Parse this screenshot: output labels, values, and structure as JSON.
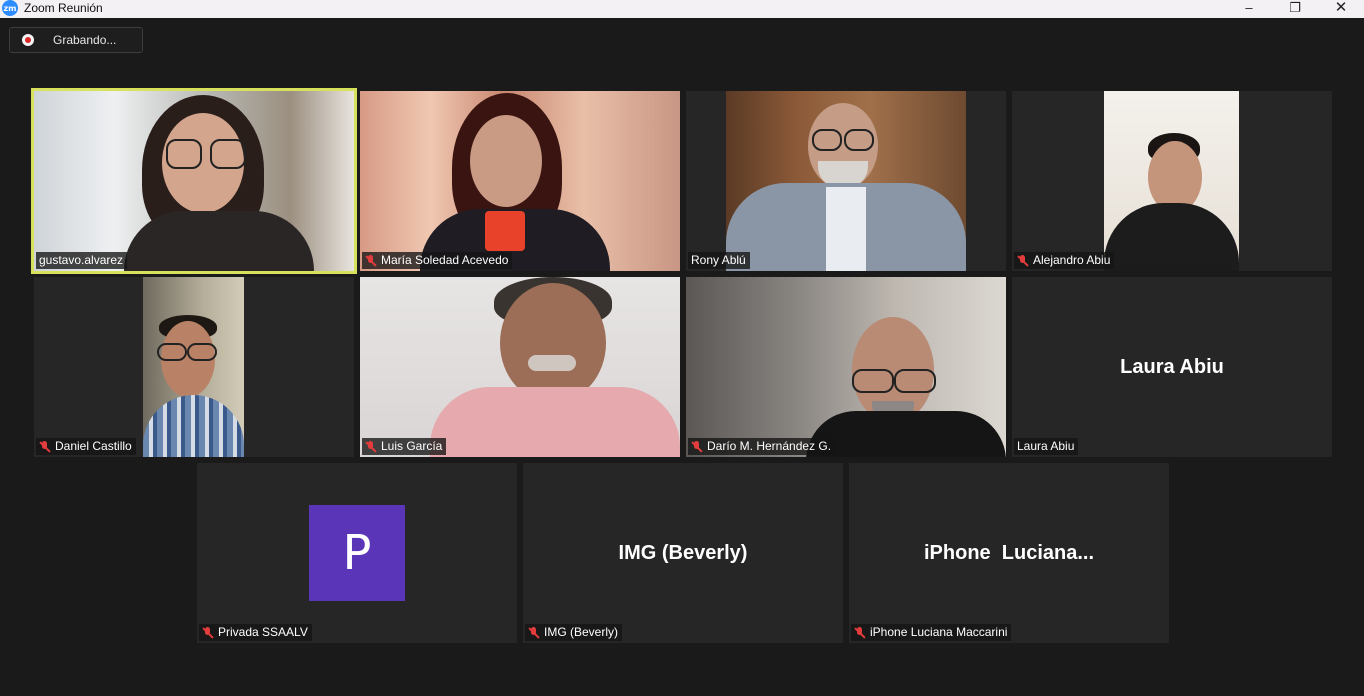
{
  "window": {
    "title": "Zoom Reunión",
    "app_icon": "zm"
  },
  "controls": {
    "minimize": "–",
    "restore": "❐",
    "close": "✕"
  },
  "recording": {
    "label": "Grabando..."
  },
  "participants": [
    {
      "name": "gustavo.alvarez",
      "muted": false,
      "speaking": true
    },
    {
      "name": "María Soledad Acevedo",
      "muted": true
    },
    {
      "name": "Rony Ablú",
      "muted": false
    },
    {
      "name": "Alejandro Abiu",
      "muted": true
    },
    {
      "name": "Daniel Castillo",
      "muted": true
    },
    {
      "name": "Luis García",
      "muted": true
    },
    {
      "name": "Darío M. Hernández G.",
      "muted": true
    },
    {
      "name": "Laura Abiu",
      "muted": false,
      "display_name": "Laura Abiu"
    },
    {
      "name": "Privada SSAALV",
      "muted": true,
      "avatar_letter": "P"
    },
    {
      "name": "IMG (Beverly)",
      "muted": true,
      "display_name": "IMG (Beverly)"
    },
    {
      "name": "iPhone Luciana Maccarini",
      "muted": true,
      "display_name": "iPhone  Luciana..."
    }
  ],
  "colors": {
    "active_speaker": "#d7e15b",
    "avatar_bg": "#5b35b8",
    "muted_icon": "#e23c3c"
  }
}
